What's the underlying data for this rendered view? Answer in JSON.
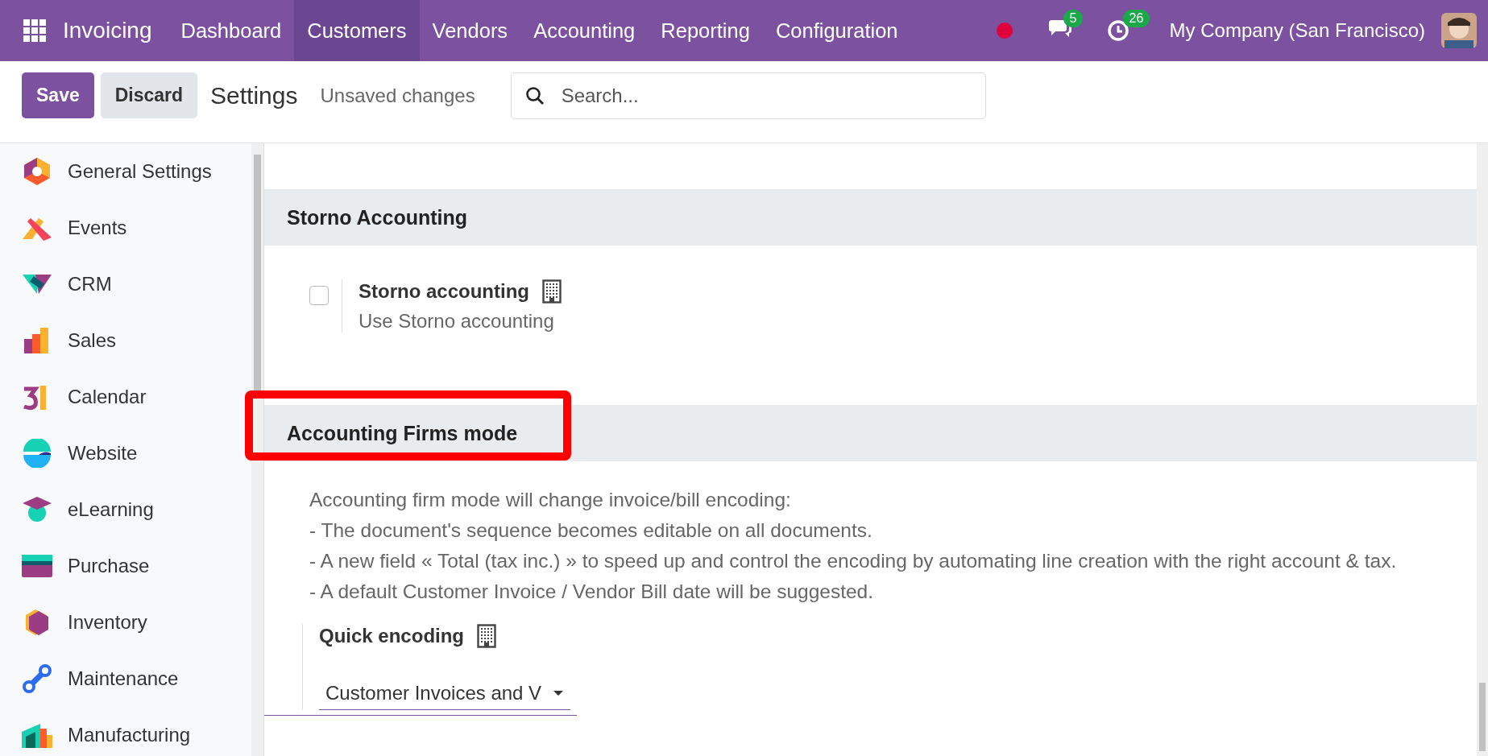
{
  "navbar": {
    "app_name": "Invoicing",
    "menu": [
      {
        "label": "Dashboard",
        "selected": false
      },
      {
        "label": "Customers",
        "selected": true
      },
      {
        "label": "Vendors",
        "selected": false
      },
      {
        "label": "Accounting",
        "selected": false
      },
      {
        "label": "Reporting",
        "selected": false
      },
      {
        "label": "Configuration",
        "selected": false
      }
    ],
    "messages_count": "5",
    "activities_count": "26",
    "company": "My Company (San Francisco)"
  },
  "control_panel": {
    "save": "Save",
    "discard": "Discard",
    "title": "Settings",
    "status": "Unsaved changes",
    "search": {
      "placeholder": "Search..."
    }
  },
  "sidebar": {
    "items": [
      {
        "label": "General Settings"
      },
      {
        "label": "Events"
      },
      {
        "label": "CRM"
      },
      {
        "label": "Sales"
      },
      {
        "label": "Calendar"
      },
      {
        "label": "Website"
      },
      {
        "label": "eLearning"
      },
      {
        "label": "Purchase"
      },
      {
        "label": "Inventory"
      },
      {
        "label": "Maintenance"
      },
      {
        "label": "Manufacturing"
      }
    ]
  },
  "sections": [
    {
      "title": "Storno Accounting",
      "highlighted": false,
      "settings": [
        {
          "kind": "checkbox",
          "label": "Storno accounting",
          "checked": false,
          "description": "Use Storno accounting"
        }
      ]
    },
    {
      "title": "Accounting Firms mode",
      "highlighted": true,
      "intro": [
        "Accounting firm mode will change invoice/bill encoding:",
        "- The document's sequence becomes editable on all documents.",
        "- A new field « Total (tax inc.) » to speed up and control the encoding by automating line creation with the right account & tax.",
        "- A default Customer Invoice / Vendor Bill date will be suggested."
      ],
      "settings": [
        {
          "kind": "select",
          "label": "Quick encoding",
          "value": "Customer Invoices and V"
        }
      ]
    }
  ]
}
